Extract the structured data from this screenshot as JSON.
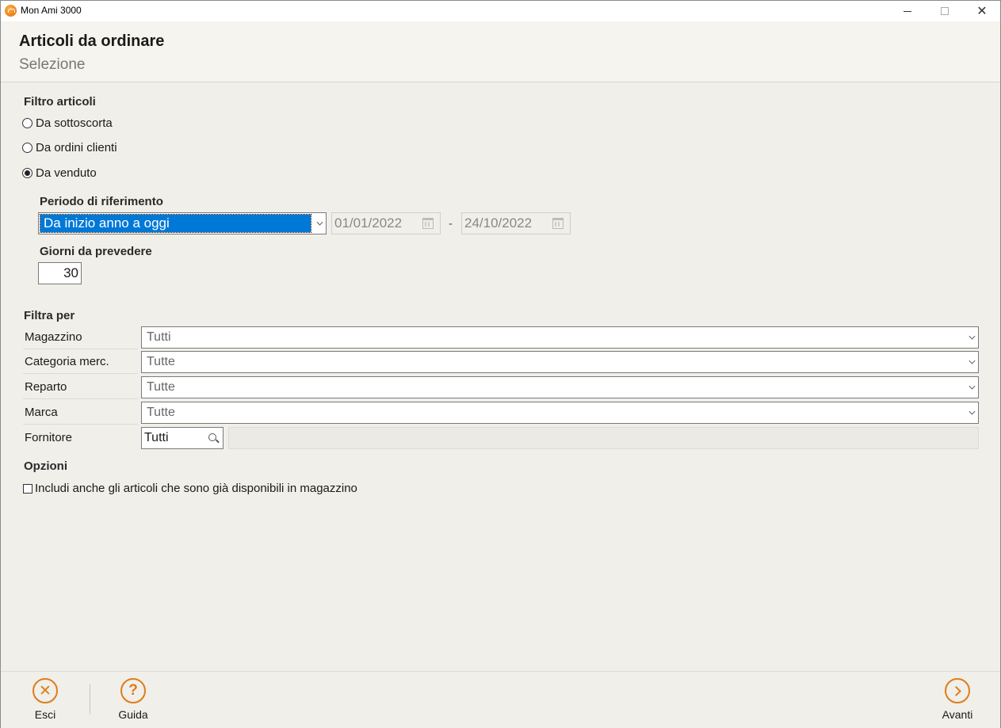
{
  "window": {
    "title": "Mon Ami 3000",
    "close_glyph": "✕"
  },
  "header": {
    "title": "Articoli da ordinare",
    "subtitle": "Selezione"
  },
  "filter_articles": {
    "label": "Filtro articoli",
    "options": [
      {
        "label": "Da sottoscorta",
        "checked": false
      },
      {
        "label": "Da ordini clienti",
        "checked": false
      },
      {
        "label": "Da venduto",
        "checked": true
      }
    ]
  },
  "period": {
    "label": "Periodo di riferimento",
    "selected": "Da inizio anno a oggi",
    "date_from": "01/01/2022",
    "separator": "-",
    "date_to": "24/10/2022"
  },
  "forecast_days": {
    "label": "Giorni da prevedere",
    "value": "30"
  },
  "filter_by": {
    "label": "Filtra per",
    "rows": [
      {
        "label": "Magazzino",
        "value": "Tutti"
      },
      {
        "label": "Categoria merc.",
        "value": "Tutte"
      },
      {
        "label": "Reparto",
        "value": "Tutte"
      },
      {
        "label": "Marca",
        "value": "Tutte"
      }
    ],
    "supplier": {
      "label": "Fornitore",
      "value": "Tutti"
    }
  },
  "options": {
    "label": "Opzioni",
    "include_available": {
      "label": "Includi anche gli articoli che sono già disponibili in magazzino",
      "checked": false
    }
  },
  "footer": {
    "exit_label": "Esci",
    "help_label": "Guida",
    "next_label": "Avanti",
    "exit_glyph": "✕",
    "help_glyph": "?"
  },
  "colors": {
    "accent": "#e07b1a",
    "selection": "#0078d7"
  }
}
